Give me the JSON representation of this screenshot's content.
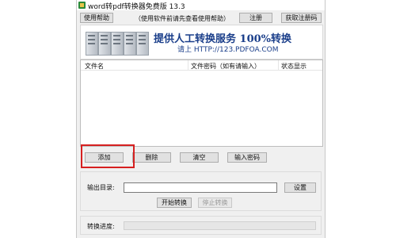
{
  "window": {
    "title": "word转pdf转换器免费版 13.3"
  },
  "toolbar": {
    "help_label": "使用帮助",
    "hint": "（使用软件前请先查看使用帮助）",
    "register_label": "注册",
    "get_code_label": "获取注册码"
  },
  "banner": {
    "headline": "提供人工转换服务 100%转换",
    "sub": "请上  HTTP://123.PDFOA.COM"
  },
  "file_list": {
    "columns": [
      "文件名",
      "文件密码（如有请输入）",
      "状态显示"
    ],
    "rows": []
  },
  "actions": {
    "add_label": "添加",
    "delete_label": "删除",
    "clear_label": "清空",
    "password_label": "输入密码"
  },
  "output": {
    "dir_label": "输出目录:",
    "dir_value": "",
    "settings_label": "设置",
    "start_label": "开始转换",
    "stop_label": "停止转换"
  },
  "progress": {
    "label": "转换进度:",
    "value": 0
  },
  "colors": {
    "highlight": "#d62020",
    "banner_text": "#1a3e8a"
  }
}
